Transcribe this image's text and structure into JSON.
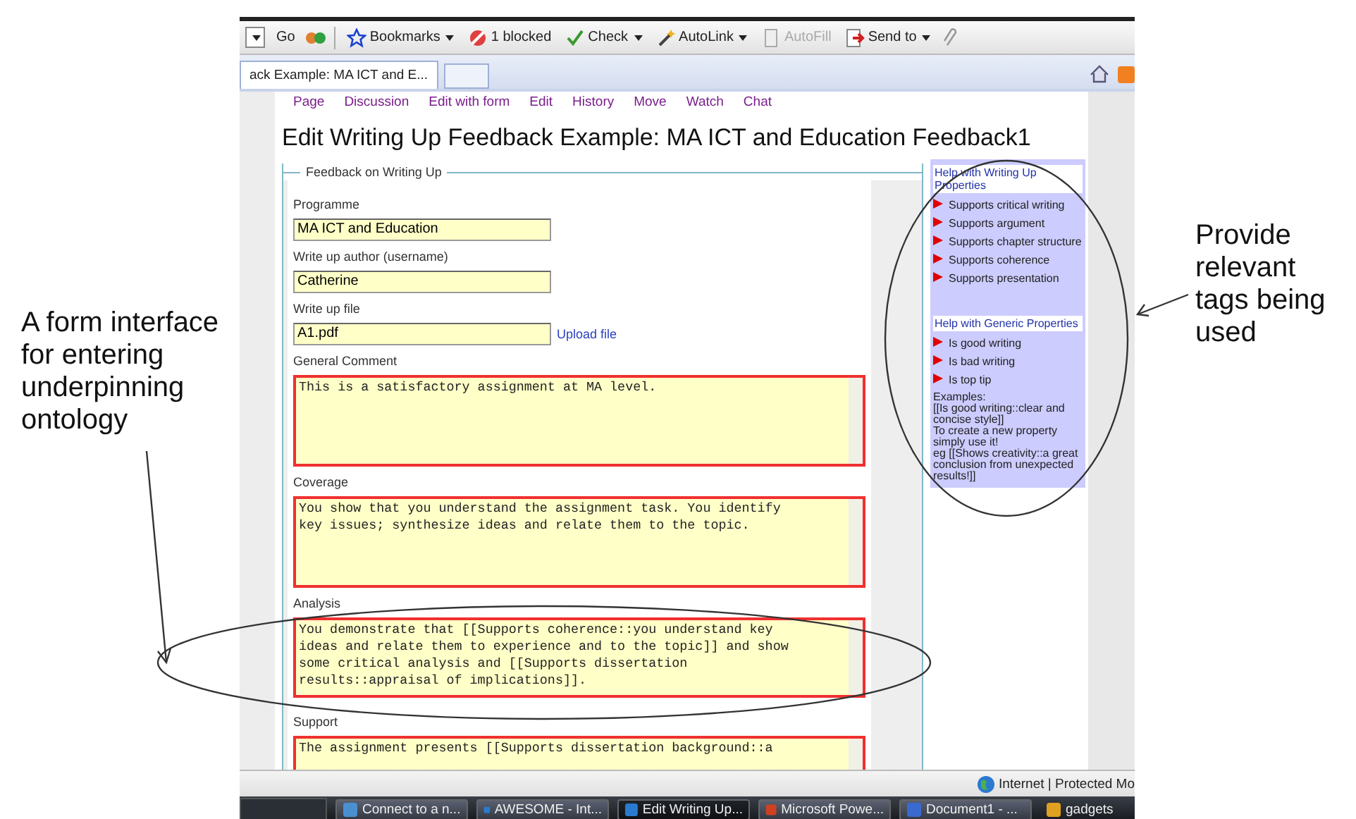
{
  "annotations": {
    "left": "A form interface for entering underpinning ontology",
    "right": "Provide relevant tags being used"
  },
  "toolbar": [
    {
      "label": "Go",
      "dropdown": false,
      "disabled": false
    },
    {
      "label": "Bookmarks",
      "dropdown": true,
      "disabled": false
    },
    {
      "label": "1 blocked",
      "dropdown": false,
      "disabled": false
    },
    {
      "label": "Check",
      "dropdown": true,
      "disabled": false
    },
    {
      "label": "AutoLink",
      "dropdown": true,
      "disabled": false
    },
    {
      "label": "AutoFill",
      "dropdown": false,
      "disabled": true
    },
    {
      "label": "Send to",
      "dropdown": true,
      "disabled": false
    }
  ],
  "tabs": [
    {
      "label": "ack Example: MA ICT and E...",
      "selected": true
    }
  ],
  "page": {
    "nav": [
      "Page",
      "Discussion",
      "Edit with form",
      "Edit",
      "History",
      "Move",
      "Watch",
      "Chat"
    ],
    "title": "Edit Writing Up Feedback Example: MA ICT and Education Feedback1",
    "form": {
      "legend": "Feedback on Writing Up",
      "fields": [
        {
          "label": "Programme",
          "kind": "text",
          "value": "MA ICT and Education"
        },
        {
          "label": "Write up author (username)",
          "kind": "text",
          "value": "Catherine"
        },
        {
          "label": "Write up file",
          "kind": "file",
          "value": "A1.pdf",
          "link": "Upload file"
        },
        {
          "label": "General Comment",
          "kind": "textarea",
          "value": "This is a satisfactory assignment at MA level."
        },
        {
          "label": "Coverage",
          "kind": "textarea",
          "value": "You show that you understand the assignment task. You identify\nkey issues; synthesize ideas and relate them to the topic."
        },
        {
          "label": "Analysis",
          "kind": "textarea",
          "value": "You demonstrate that [[Supports coherence::you understand key\nideas and relate them to experience and to the topic]] and show\nsome critical analysis and [[Supports dissertation\nresults::appraisal of implications]]."
        },
        {
          "label": "Support",
          "kind": "textarea",
          "value": "The assignment presents [[Supports dissertation background::a"
        }
      ]
    },
    "help": [
      {
        "heading": "Help with Writing Up Properties",
        "items": [
          "Supports critical writing",
          "Supports argument",
          "Supports chapter structure",
          "Supports coherence",
          "Supports presentation"
        ]
      },
      {
        "heading": "Help with Generic Properties",
        "items": [
          "Is good writing",
          "Is bad writing",
          "Is top tip"
        ],
        "notes": [
          "Examples:",
          "[[Is good writing::clear and concise style]]",
          "To create a new property simply use it!",
          "eg [[Shows creativity::a great conclusion from unexpected results!]]"
        ]
      }
    ]
  },
  "status_bar": {
    "zone": "Internet | Protected Mo"
  },
  "taskbar": [
    {
      "label": "Connect to a n...",
      "selected": false
    },
    {
      "label": "AWESOME - Int...",
      "selected": false
    },
    {
      "label": "Edit Writing Up...",
      "selected": true
    },
    {
      "label": "Microsoft Powe...",
      "selected": false
    },
    {
      "label": "Document1 - ...",
      "selected": false
    },
    {
      "label": "gadgets",
      "selected": false
    }
  ]
}
